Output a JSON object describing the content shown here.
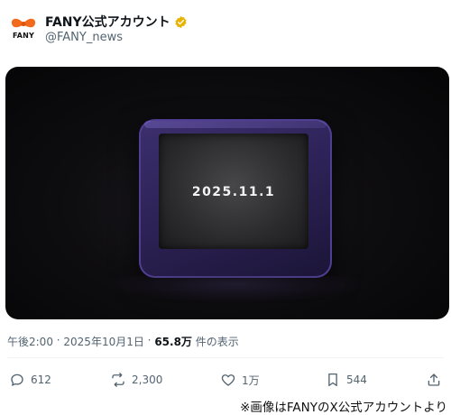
{
  "account": {
    "display_name": "FANY公式アカウント",
    "handle": "@FANY_news",
    "avatar_text": "FANY",
    "verified_color": "#e8b200"
  },
  "media": {
    "screen_text": "2025.11.1",
    "frame_color": "#3c2f6e"
  },
  "meta": {
    "time": "午後2:00",
    "separator": " · ",
    "date": "2025年10月1日",
    "views": "65.8万",
    "views_suffix": " 件の表示"
  },
  "actions": {
    "reply_count": "612",
    "repost_count": "2,300",
    "like_count": "1万",
    "bookmark_count": "544"
  },
  "caption": "※画像はFANYのX公式アカウントより"
}
